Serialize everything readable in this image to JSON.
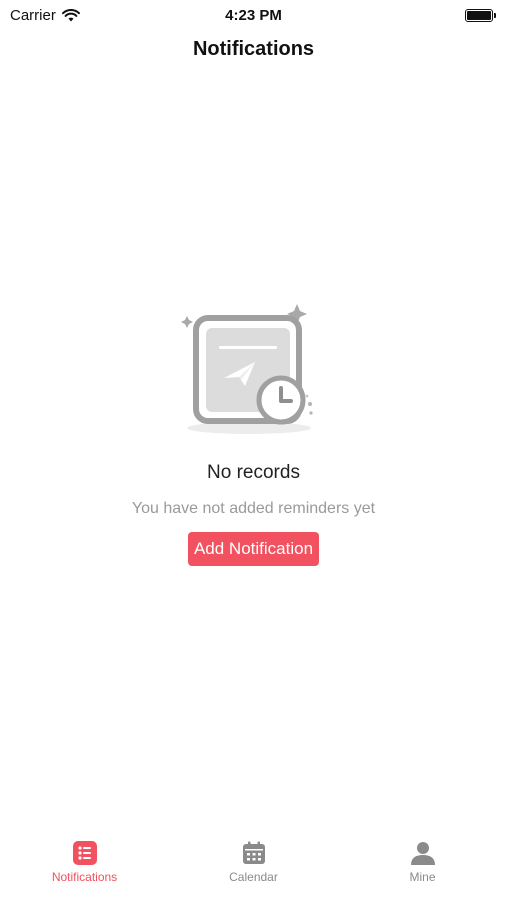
{
  "status_bar": {
    "carrier": "Carrier",
    "time": "4:23 PM"
  },
  "nav": {
    "title": "Notifications"
  },
  "empty_state": {
    "icon": "paper-plane-clock-illustration",
    "title": "No records",
    "subtitle": "You have not added reminders yet",
    "button_label": "Add Notification"
  },
  "tab_bar": {
    "tabs": [
      {
        "label": "Notifications",
        "icon": "list-icon",
        "active": true
      },
      {
        "label": "Calendar",
        "icon": "calendar-icon",
        "active": false
      },
      {
        "label": "Mine",
        "icon": "person-icon",
        "active": false
      }
    ]
  },
  "colors": {
    "accent": "#f2515f",
    "inactive": "#8a8a8a",
    "subtitle": "#9a9a9a"
  }
}
